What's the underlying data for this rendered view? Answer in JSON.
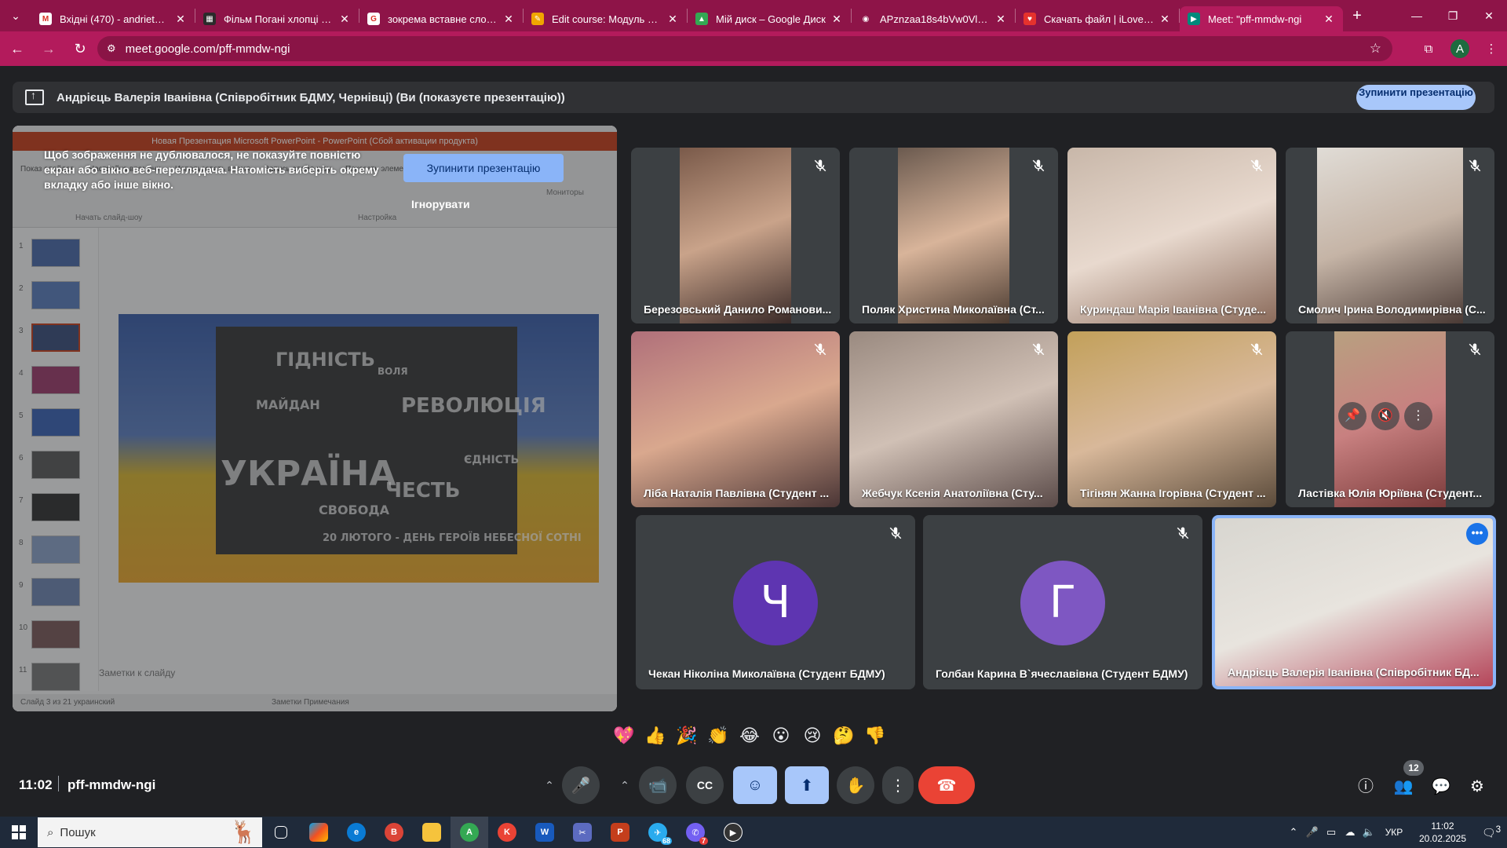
{
  "browser": {
    "tabs": [
      {
        "title": "Вхідні (470) - andriets.vale",
        "icon": "gmail-icon",
        "color": "#ffffff",
        "glyph": "M"
      },
      {
        "title": "Фільм Погані хлопці (199",
        "icon": "film-site-icon",
        "color": "#2b2b2b",
        "glyph": "▦"
      },
      {
        "title": "зокрема вставне слово -",
        "icon": "google-icon",
        "color": "#ffffff",
        "glyph": "G"
      },
      {
        "title": "Edit course: Модуль 1. Іст",
        "icon": "moodle-icon",
        "color": "#f0a500",
        "glyph": "✎"
      },
      {
        "title": "Мій диск – Google Диск",
        "icon": "google-drive-icon",
        "color": "#34a853",
        "glyph": "▲"
      },
      {
        "title": "APznzaa18s4bVw0VlSoAE",
        "icon": "globe-icon",
        "color": "#8e1448",
        "glyph": "◉"
      },
      {
        "title": "Скачать файл | iLovePDF",
        "icon": "ilovepdf-icon",
        "color": "#e5322d",
        "glyph": "♥"
      },
      {
        "title": "Meet: \"pff-mmdw-ngi",
        "icon": "google-meet-icon",
        "color": "#00897b",
        "glyph": "▶"
      }
    ],
    "url": "meet.google.com/pff-mmdw-ngi",
    "profile_initial": "A"
  },
  "meet": {
    "presenting_text": "Андрієць Валерія Іванівна (Співробітник БДМУ, Чернівці) (Ви (показуєте презентацію))",
    "stop_presenting_top": "Зупинити презентацію",
    "warning_text": "Щоб зображення не дублювалося, не показуйте повністю екран або вікно веб-переглядача. Натомість виберіть окрему вкладку або інше вікно.",
    "warning_stop": "Зупинити презентацію",
    "warning_ignore": "Ігнорувати",
    "preview": {
      "ppt_title": "Новая Презентация Microsoft PowerPoint - PowerPoint (Сбой активации продукта)",
      "ribbon_items": [
        "Показ слайдов",
        "Настройка времени",
        "Использовать время",
        "Запись слайд-шоу",
        "Показать элементы управления"
      ],
      "ribbon_group": "Настройка",
      "slide_group": "Начать слайд-шоу",
      "monitors": "Мониторы",
      "slide_words": [
        "ГІДНІСТЬ",
        "ВОЛЯ",
        "РЕВОЛЮЦІЯ",
        "МАЙДАН",
        "УКРАЇНА",
        "ЧЕСТЬ",
        "СВОБОДА",
        "ЄДНІСТЬ",
        "20 ЛЮТОГО - ДЕНЬ ГЕРОЇВ НЕБЕСНОЇ СОТНІ"
      ],
      "notes": "Заметки к слайду",
      "status": "Слайд 3 из 21    украинский",
      "status_right": "Заметки    Примечания",
      "thumb_numbers": [
        "1",
        "2",
        "3",
        "4",
        "5",
        "6",
        "7",
        "8",
        "9",
        "10",
        "11"
      ]
    },
    "participants": [
      {
        "name": "Березовський Данило Романови...",
        "muted": true
      },
      {
        "name": "Поляк Христина Миколаївна (Ст...",
        "muted": true
      },
      {
        "name": "Куриндаш Марія Іванівна (Студе...",
        "muted": true
      },
      {
        "name": "Смолич Ірина Володимирівна (С...",
        "muted": true
      },
      {
        "name": "Ліба Наталія Павлівна (Студент ...",
        "muted": true
      },
      {
        "name": "Жебчук Ксенія Анатоліївна (Сту...",
        "muted": true
      },
      {
        "name": "Тігінян Жанна Ігорівна (Студент ...",
        "muted": true
      },
      {
        "name": "Ластівка Юлія Юріївна (Студент...",
        "muted": true
      },
      {
        "name": "Чекан Ніколіна Миколаївна (Студент БДМУ)",
        "muted": true,
        "initial": "Ч",
        "color": "#5e35b1"
      },
      {
        "name": "Голбан Карина В`ячеславівна (Студент БДМУ)",
        "muted": true,
        "initial": "Г",
        "color": "#7e57c2"
      },
      {
        "name": "Андрієць Валерія Іванівна (Співробітник БД...",
        "muted": false
      }
    ],
    "reactions": [
      "💖",
      "👍",
      "🎉",
      "👏",
      "😂",
      "😮",
      "😢",
      "🤔",
      "👎"
    ],
    "time": "11:02",
    "code": "pff-mmdw-ngi",
    "participants_count": "12"
  },
  "taskbar": {
    "search_placeholder": "Пошук",
    "lang": "УКР",
    "time": "11:02",
    "date": "20.02.2025",
    "notifications": "3",
    "telegram_badge": "68",
    "viber_badge": "7"
  }
}
